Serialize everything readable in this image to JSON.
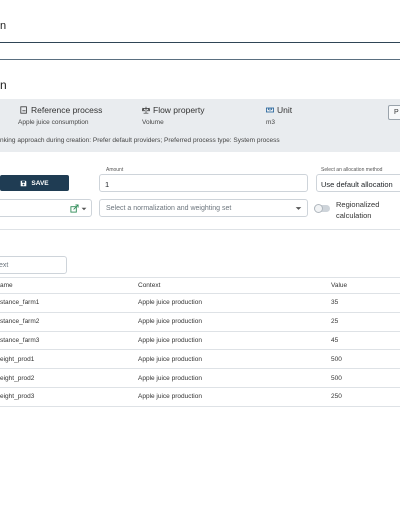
{
  "topbar": {
    "title": "n"
  },
  "page": {
    "title": "n"
  },
  "info": {
    "reference_process_label": "Reference process",
    "reference_process_value": "Apple juice consumption",
    "flow_property_label": "Flow property",
    "flow_property_value": "Volume",
    "unit_label": "Unit",
    "unit_value": "m3",
    "note": "nking approach during creation: Prefer default providers; Preferred process type: System process",
    "side_button": "P"
  },
  "form": {
    "save_label": "SAVE",
    "amount_label": "Amount",
    "amount_value": "1",
    "allocation_label": "Select an allocation method",
    "allocation_value": "Use default allocation",
    "normalization_placeholder": "Select a normalization and weighting set",
    "regionalized_line1": "Regionalized",
    "regionalized_line2": "calculation",
    "filter_placeholder": "ext"
  },
  "table": {
    "headers": [
      "ame",
      "Context",
      "Value"
    ],
    "rows": [
      [
        "stance_farm1",
        "Apple juice production",
        "35"
      ],
      [
        "stance_farm2",
        "Apple juice production",
        "25"
      ],
      [
        "stance_farm3",
        "Apple juice production",
        "45"
      ],
      [
        "eight_prod1",
        "Apple juice production",
        "500"
      ],
      [
        "eight_prod2",
        "Apple juice production",
        "500"
      ],
      [
        "eight_prod3",
        "Apple juice production",
        "250"
      ]
    ]
  },
  "colors": {
    "primary": "#1f3c53",
    "infobar": "#e9ecef",
    "border": "#ced4da"
  }
}
